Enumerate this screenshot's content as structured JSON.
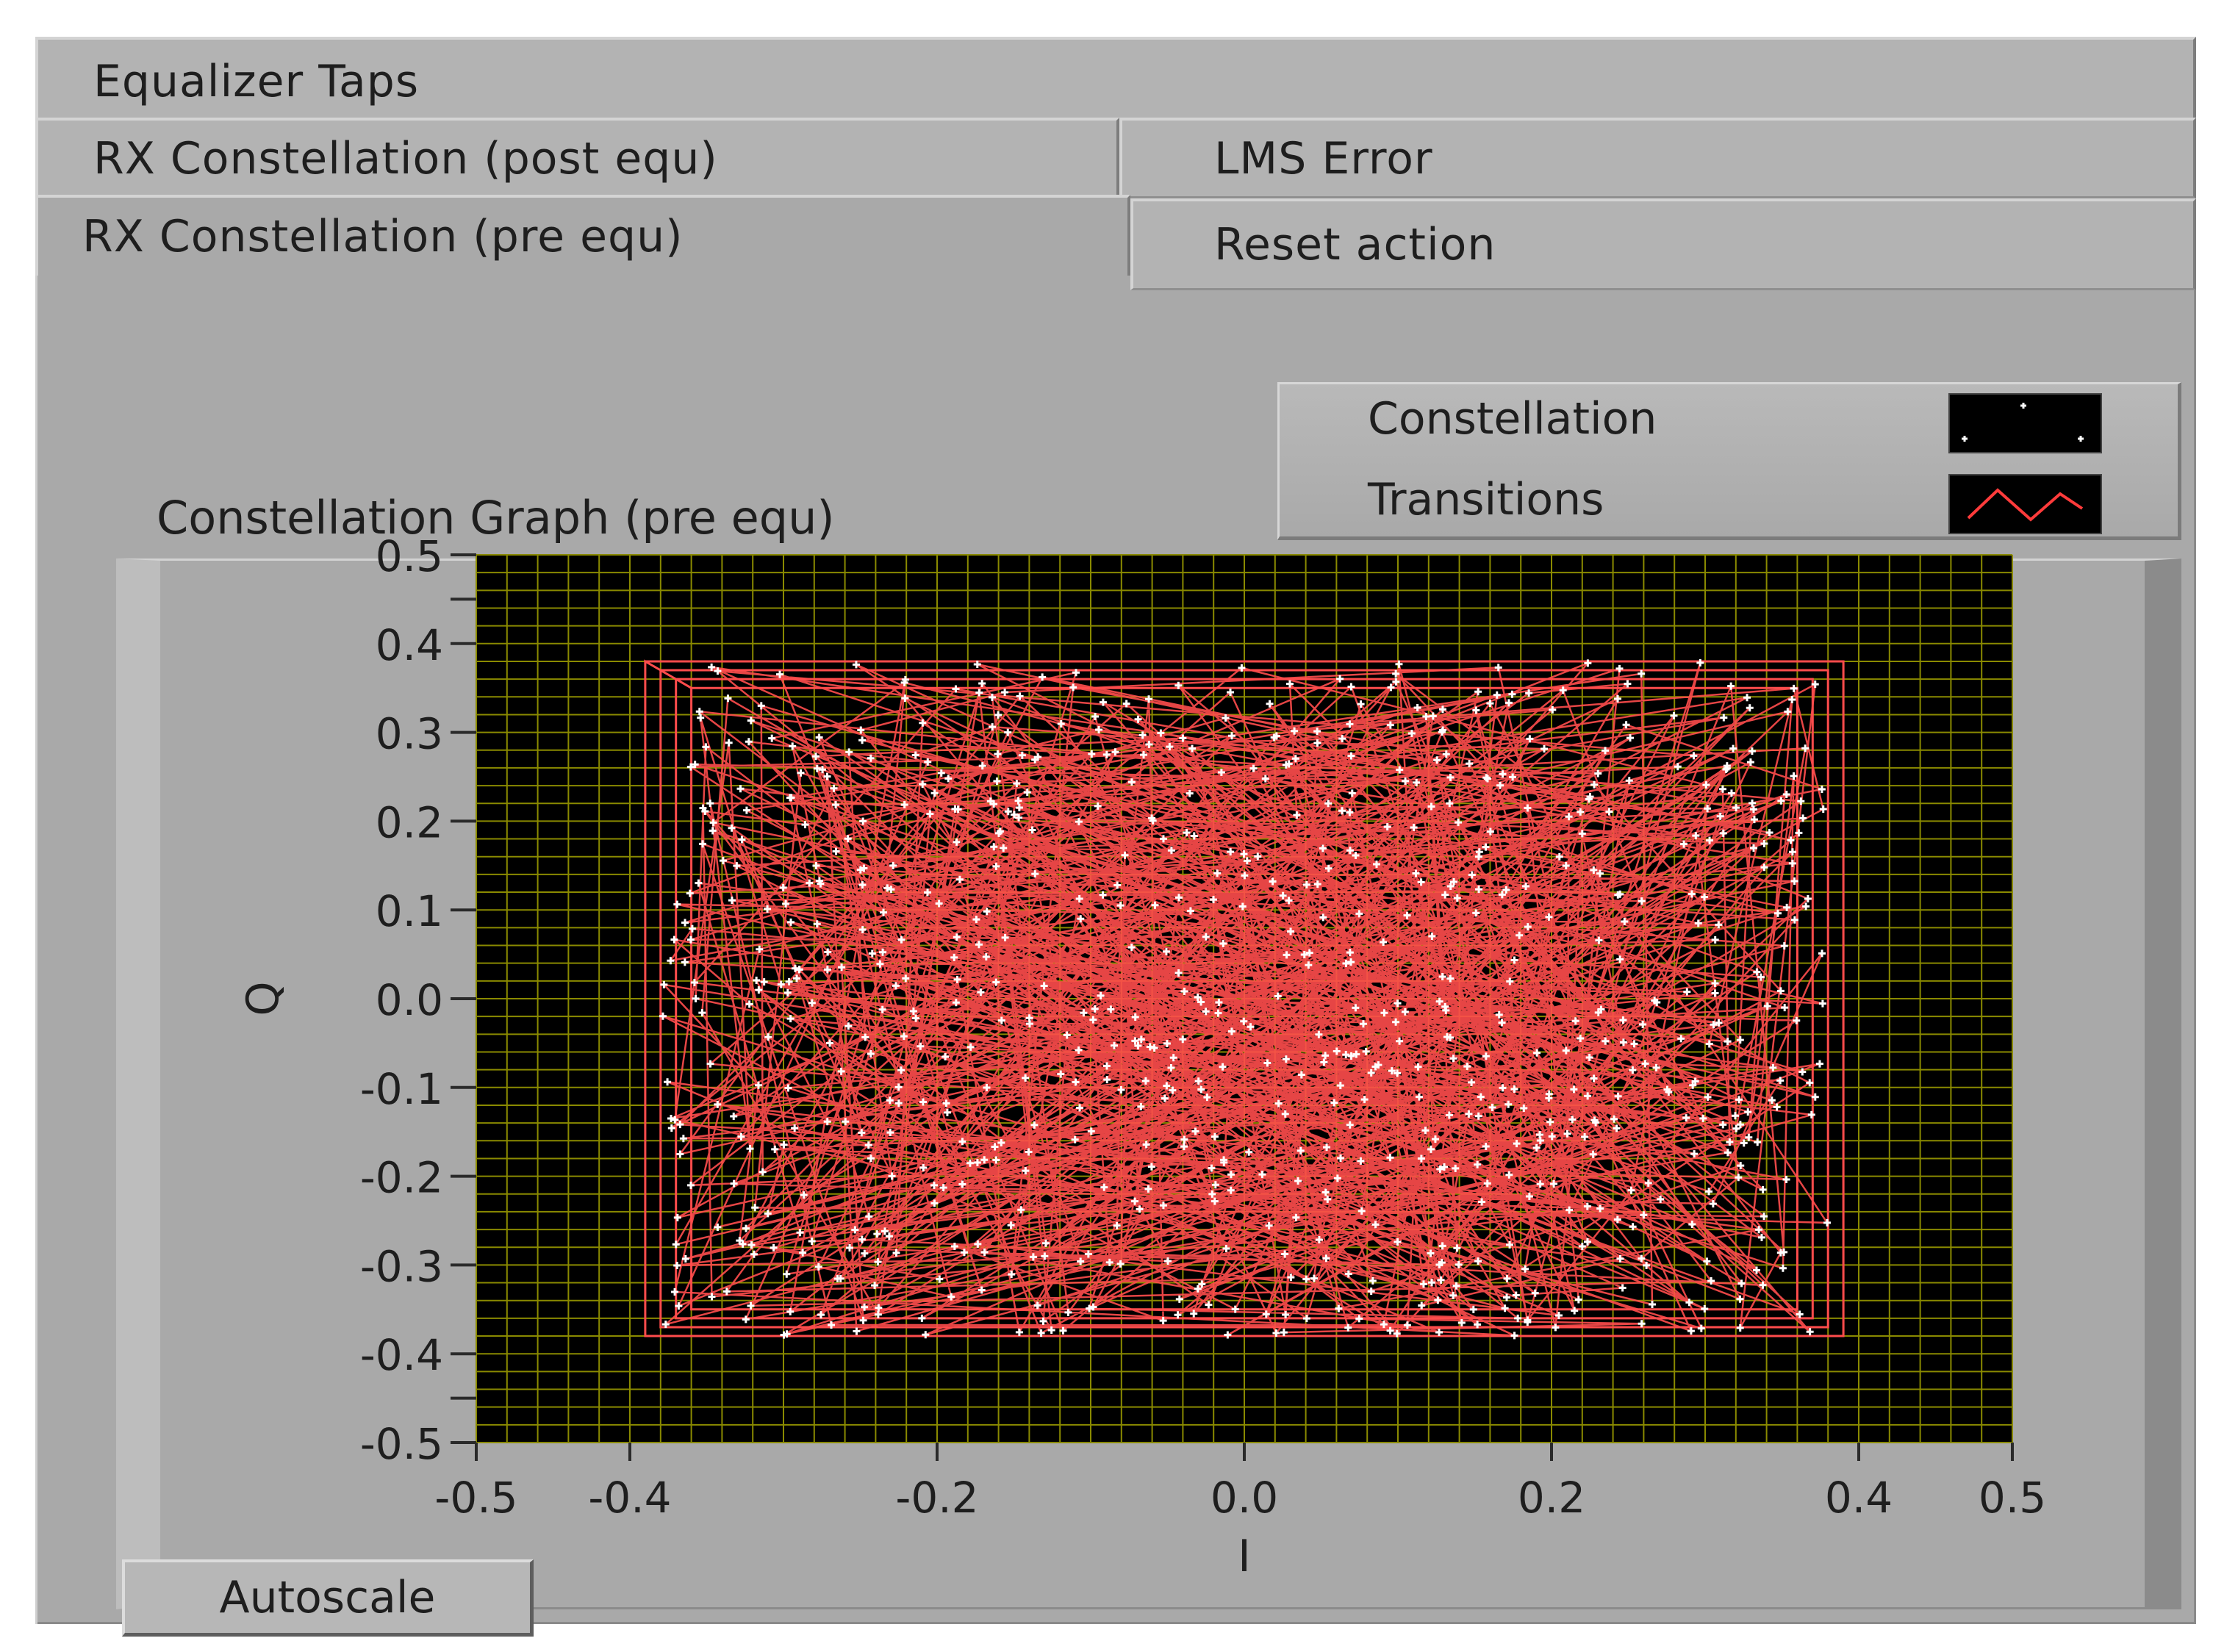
{
  "tabs": [
    {
      "label": "Equalizer Taps"
    },
    {
      "label": "RX Constellation (post equ)"
    },
    {
      "label": "LMS Error"
    },
    {
      "label": "RX Constellation (pre equ)"
    },
    {
      "label": "Reset action"
    }
  ],
  "legend": {
    "items": [
      {
        "label": "Constellation",
        "icon": "constellation-points-icon"
      },
      {
        "label": "Transitions",
        "icon": "transition-line-icon"
      }
    ]
  },
  "graph": {
    "title": "Constellation Graph (pre equ)"
  },
  "buttons": {
    "autoscale": "Autoscale"
  },
  "colors": {
    "plot_background": "#000000",
    "grid": "#8a8a00",
    "transitions": "#ff4c4c",
    "points": "#ffffff",
    "panel": "#a9a9a9"
  },
  "chart_data": {
    "type": "scatter",
    "title": "Constellation Graph (pre equ)",
    "xlabel": "I",
    "ylabel": "Q",
    "xlim": [
      -0.5,
      0.5
    ],
    "ylim": [
      -0.5,
      0.5
    ],
    "x_ticks": [
      "-0.5",
      "-0.4",
      "-0.2",
      "0.0",
      "0.2",
      "0.4",
      "0.5"
    ],
    "y_ticks": [
      "0.5",
      "0.4",
      "0.3",
      "0.2",
      "0.1",
      "0.0",
      "-0.1",
      "-0.2",
      "-0.3",
      "-0.4",
      "-0.5"
    ],
    "grid": true,
    "legend_position": "top-right",
    "series": [
      {
        "name": "Constellation",
        "kind": "points",
        "color": "#ffffff",
        "x_range": [
          -0.38,
          0.38
        ],
        "y_range": [
          -0.38,
          0.38
        ]
      },
      {
        "name": "Transitions",
        "kind": "line",
        "color": "#ff4c4c",
        "x_range": [
          -0.39,
          0.39
        ],
        "y_range": [
          -0.38,
          0.38
        ]
      }
    ]
  }
}
